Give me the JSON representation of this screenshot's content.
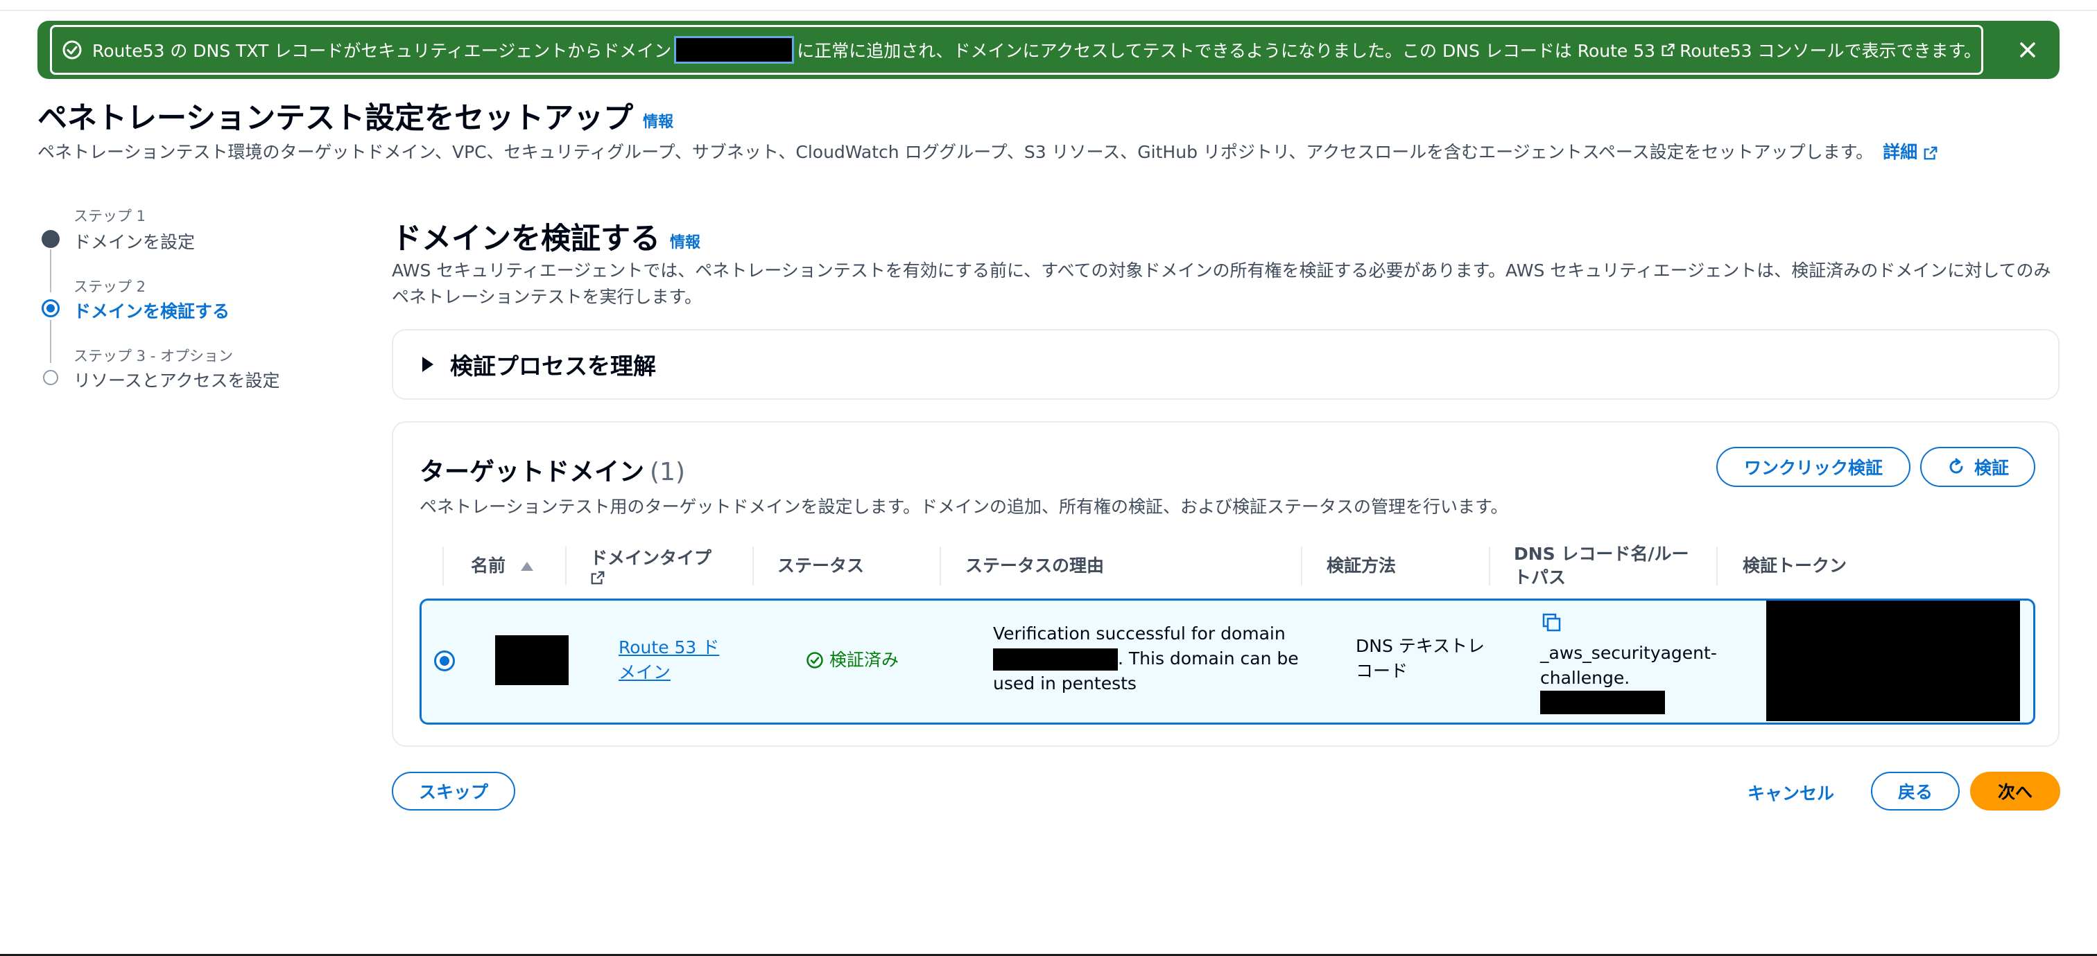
{
  "flash": {
    "message_before": "Route53 の DNS TXT レコードがセキュリティエージェントからドメイン",
    "message_after": "に正常に追加され、ドメインにアクセスしてテストできるようになりました。この DNS レコードは Route 53",
    "link_label": "Route53 コンソールで表示できます。",
    "color": "#2d7a33"
  },
  "header": {
    "title": "ペネトレーションテスト設定をセットアップ",
    "info": "情報",
    "description": "ペネトレーションテスト環境のターゲットドメイン、VPC、セキュリティグループ、サブネット、CloudWatch ロググループ、S3 リソース、GitHub リポジトリ、アクセスロールを含むエージェントスペース設定をセットアップします。",
    "more_link": "詳細"
  },
  "steps": [
    {
      "kicker": "ステップ 1",
      "label": "ドメインを設定",
      "state": "completed"
    },
    {
      "kicker": "ステップ 2",
      "label": "ドメインを検証する",
      "state": "active"
    },
    {
      "kicker": "ステップ 3 - オプション",
      "label": "リソースとアクセスを設定",
      "state": "pending"
    }
  ],
  "main": {
    "title": "ドメインを検証する",
    "info": "情報",
    "description": "AWS セキュリティエージェントでは、ペネトレーションテストを有効にする前に、すべての対象ドメインの所有権を検証する必要があります。AWS セキュリティエージェントは、検証済みのドメインに対してのみペネトレーションテストを実行します。",
    "expander_label": "検証プロセスを理解"
  },
  "domains": {
    "title": "ターゲットドメイン",
    "count": "(1)",
    "description": "ペネトレーションテスト用のターゲットドメインを設定します。ドメインの追加、所有権の検証、および検証ステータスの管理を行います。",
    "one_click_button": "ワンクリック検証",
    "verify_button": "検証",
    "columns": {
      "name": "名前",
      "domain_type": "ドメインタイプ",
      "status": "ステータス",
      "status_reason": "ステータスの理由",
      "method": "検証方法",
      "dns_record": "DNS レコード名/ルートパス",
      "token": "検証トークン"
    },
    "row": {
      "domain_type": "Route 53 ドメイン",
      "status": "検証済み",
      "reason_line1": "Verification successful for domain",
      "reason_line2": ". This domain can be",
      "reason_line3": "used in pentests",
      "method": "DNS テキストレコード",
      "dns_record_line1": "_aws_securityagent-",
      "dns_record_line2": "challenge."
    }
  },
  "footer": {
    "skip": "スキップ",
    "cancel": "キャンセル",
    "back": "戻る",
    "next": "次へ"
  },
  "colors": {
    "accent": "#0972d3",
    "primary_button": "#ff9900",
    "success": "#037f0c"
  }
}
